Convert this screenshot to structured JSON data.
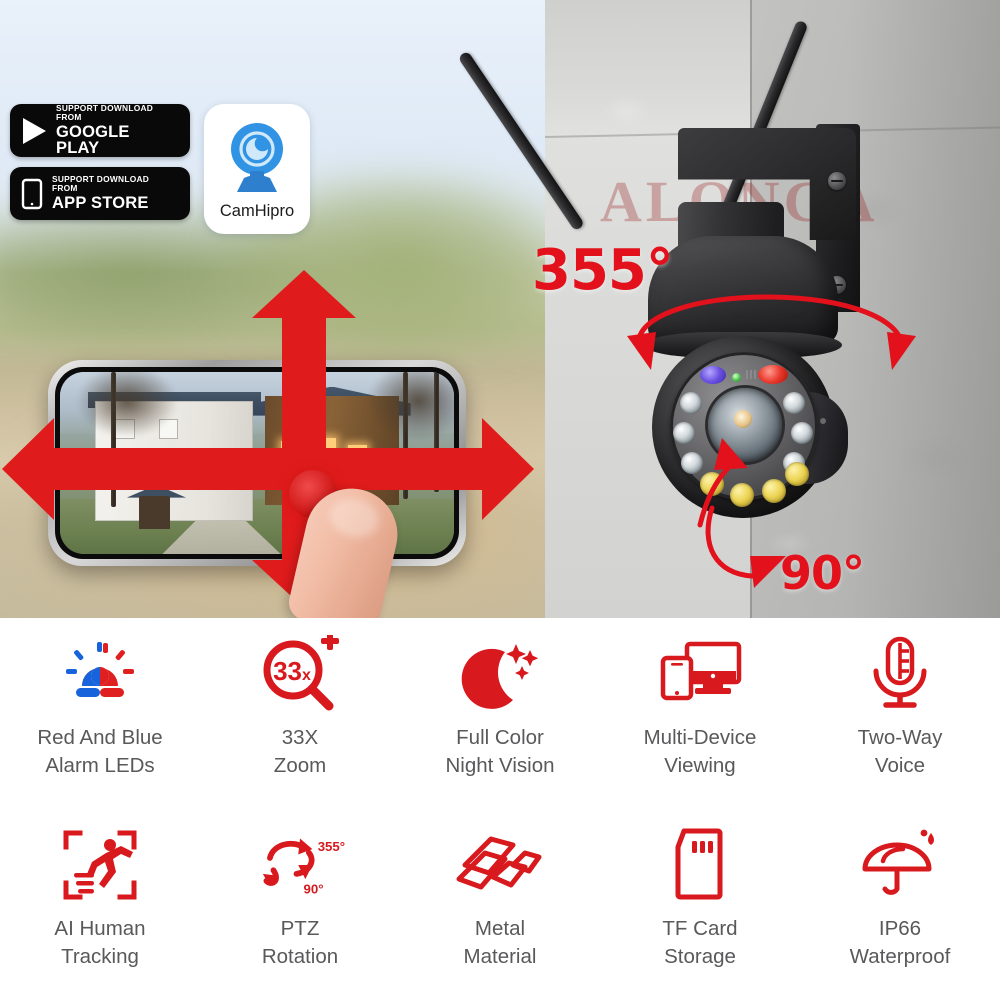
{
  "hero": {
    "badges": [
      {
        "id": "google-play",
        "icon": "play-triangle-icon",
        "line1": "SUPPORT DOWNLOAD FROM",
        "line2": "GOOGLE PLAY"
      },
      {
        "id": "app-store",
        "icon": "phone-outline-icon",
        "line1": "SUPPORT DOWNLOAD FROM",
        "line2": "APP STORE"
      }
    ],
    "app": {
      "name": "CamHipro",
      "icon": "camhipro-camera-icon"
    },
    "watermark": "ALONGA",
    "annotations": {
      "pan": "355°",
      "tilt": "90°"
    },
    "phone": {
      "alt_scene": "house-live-view",
      "touch_icon": "touch-point-icon"
    }
  },
  "colors": {
    "accent_red": "#D8191D",
    "annotation_red": "#E2111B",
    "label_gray": "#59595B",
    "led_blue": "#6A4FE0",
    "badge_black": "#090909",
    "logo_blue": "#2C8FE0"
  },
  "features": [
    {
      "icon": "alarm-siren-icon",
      "label": "Red And Blue\nAlarm LEDs"
    },
    {
      "icon": "zoom-magnifier-33x-icon",
      "label": "33X\nZoom",
      "badge": "33",
      "suffix": "x"
    },
    {
      "icon": "moon-stars-icon",
      "label": "Full Color\nNight Vision"
    },
    {
      "icon": "multi-device-icon",
      "label": "Multi-Device\nViewing"
    },
    {
      "icon": "microphone-icon",
      "label": "Two-Way\nVoice"
    },
    {
      "icon": "human-tracking-icon",
      "label": "AI Human\nTracking"
    },
    {
      "icon": "ptz-rotation-icon",
      "label": "PTZ\nRotation",
      "deg_pan": "355°",
      "deg_tilt": "90°"
    },
    {
      "icon": "metal-bars-icon",
      "label": "Metal\nMaterial"
    },
    {
      "icon": "tf-card-icon",
      "label": "TF Card\nStorage"
    },
    {
      "icon": "umbrella-icon",
      "label": "IP66\nWaterproof"
    }
  ]
}
